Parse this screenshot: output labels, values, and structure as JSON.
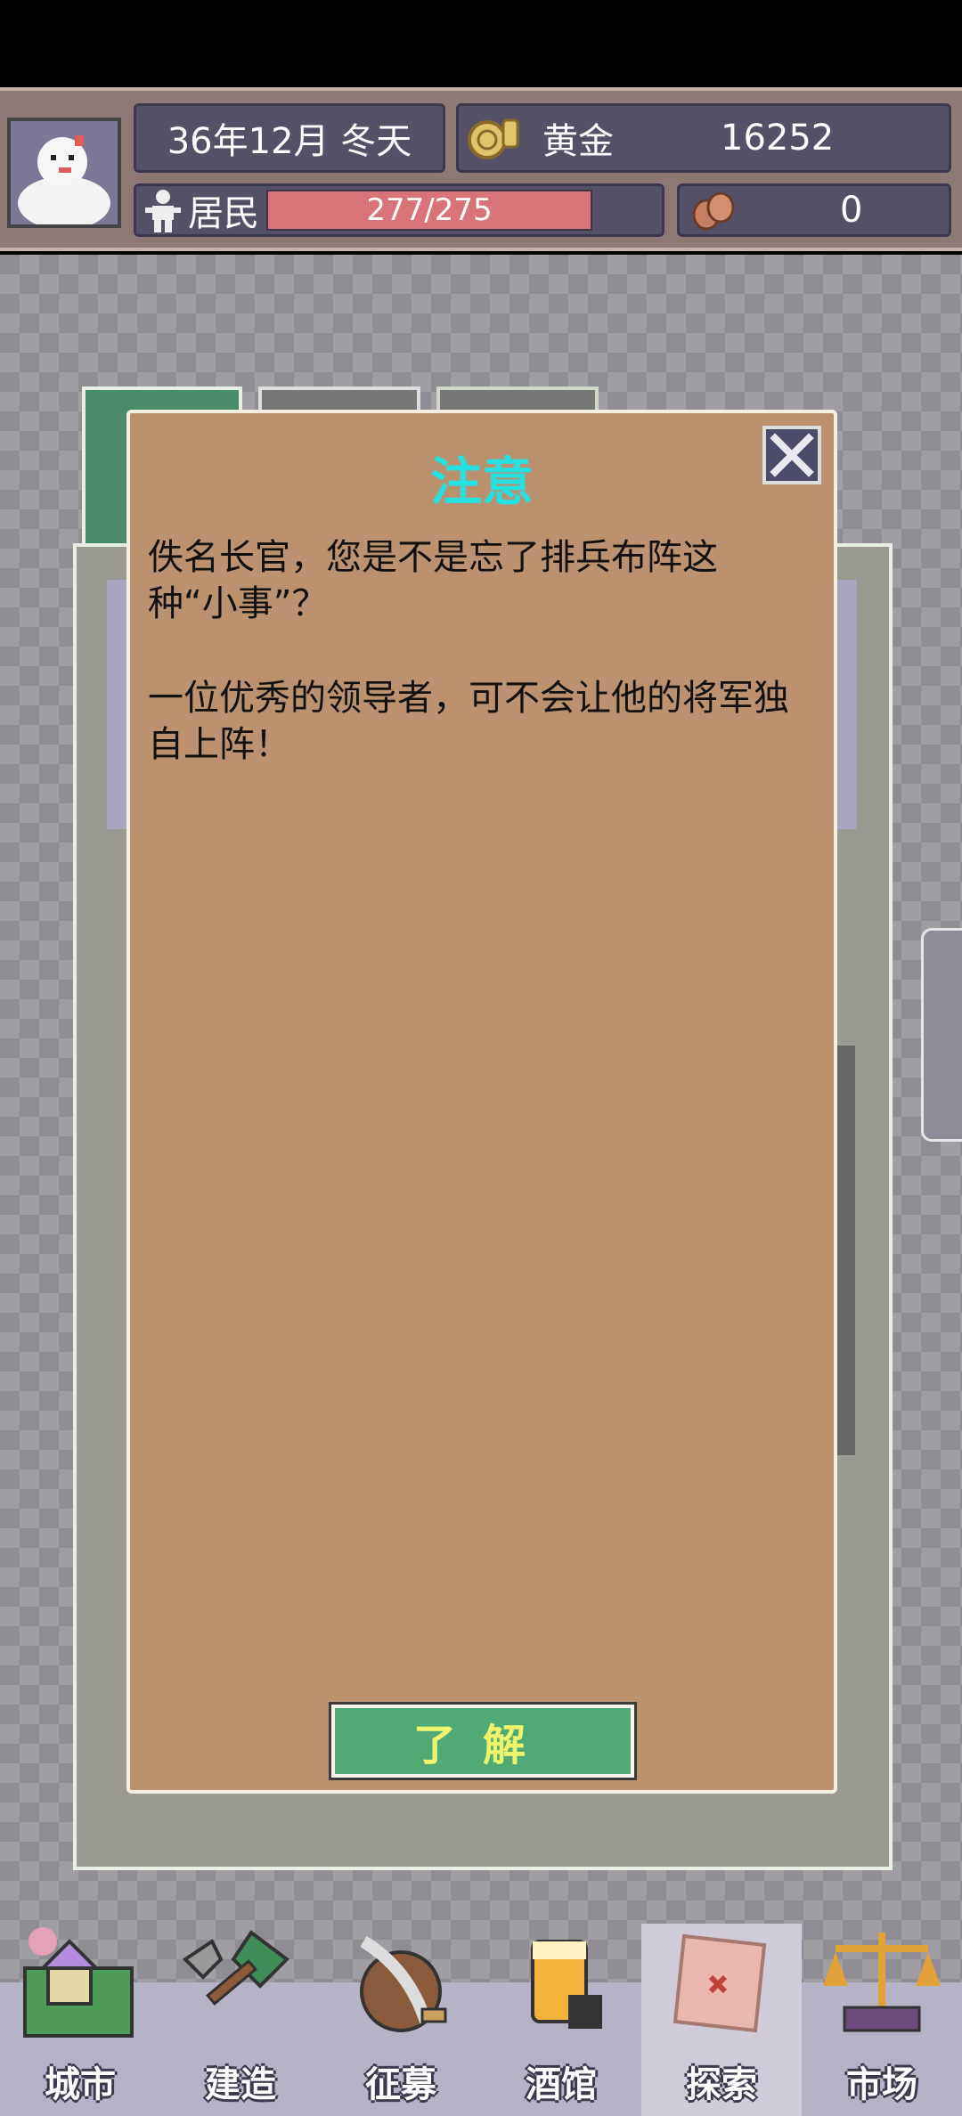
{
  "header": {
    "date": "36年12月 冬天",
    "gold_label": "黄金",
    "gold_value": "16252",
    "residents_label": "居民",
    "residents_value": "277/275",
    "residents_fill": 1.0,
    "other_value": "0"
  },
  "dialog": {
    "title": "注意",
    "paragraphs": [
      "佚名长官，您是不是忘了排兵布阵这种“小事”？",
      "一位优秀的领导者，可不会让他的将军独自上阵！"
    ],
    "confirm_label": "了解"
  },
  "nav": {
    "items": [
      {
        "label": "城市",
        "icon": "city-icon"
      },
      {
        "label": "建造",
        "icon": "build-icon"
      },
      {
        "label": "征募",
        "icon": "recruit-icon"
      },
      {
        "label": "酒馆",
        "icon": "tavern-icon"
      },
      {
        "label": "探索",
        "icon": "explore-icon"
      },
      {
        "label": "市场",
        "icon": "market-icon"
      }
    ]
  },
  "colors": {
    "dialog_bg": "#bb9270",
    "title": "#27e0e0",
    "confirm_bg": "#4faa76",
    "confirm_text": "#f1f46b",
    "resident_bar": "#d9737a"
  }
}
